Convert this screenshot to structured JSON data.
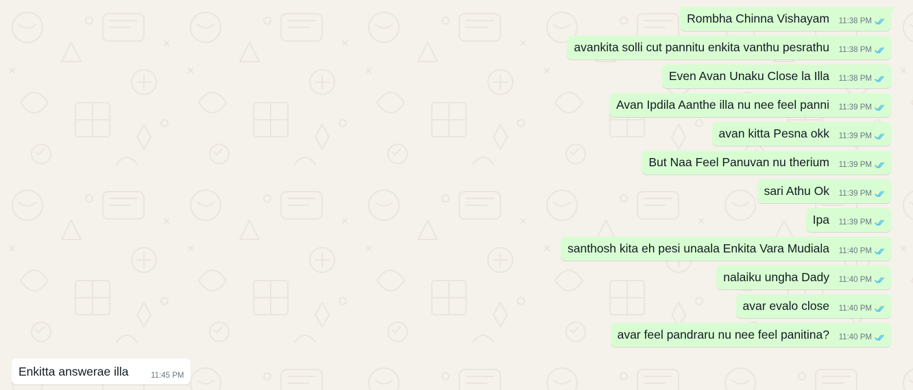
{
  "colors": {
    "outgoing_bubble": "#d9fdd3",
    "incoming_bubble": "#ffffff",
    "read_tick": "#53bdeb",
    "chat_background": "#f5f1eb"
  },
  "icons": {
    "read_receipt": "double-check-icon"
  },
  "messages": [
    {
      "direction": "out",
      "text": "Rombha Chinna Vishayam",
      "time": "11:38 PM",
      "status": "read"
    },
    {
      "direction": "out",
      "text": "avankita solli cut pannitu enkita vanthu pesrathu",
      "time": "11:38 PM",
      "status": "read"
    },
    {
      "direction": "out",
      "text": "Even Avan Unaku Close la Illa",
      "time": "11:38 PM",
      "status": "read"
    },
    {
      "direction": "out",
      "text": "Avan Ipdila Aanthe illa nu nee feel panni",
      "time": "11:39 PM",
      "status": "read"
    },
    {
      "direction": "out",
      "text": "avan kitta Pesna okk",
      "time": "11:39 PM",
      "status": "read"
    },
    {
      "direction": "out",
      "text": "But Naa Feel Panuvan nu therium",
      "time": "11:39 PM",
      "status": "read"
    },
    {
      "direction": "out",
      "text": "sari Athu Ok",
      "time": "11:39 PM",
      "status": "read"
    },
    {
      "direction": "out",
      "text": "Ipa",
      "time": "11:39 PM",
      "status": "read"
    },
    {
      "direction": "out",
      "text": "santhosh kita eh pesi unaala Enkita Vara Mudiala",
      "time": "11:40 PM",
      "status": "read"
    },
    {
      "direction": "out",
      "text": "nalaiku ungha Dady",
      "time": "11:40 PM",
      "status": "read"
    },
    {
      "direction": "out",
      "text": "avar evalo close",
      "time": "11:40 PM",
      "status": "read"
    },
    {
      "direction": "out",
      "text": "avar feel pandraru nu nee feel panitina?",
      "time": "11:40 PM",
      "status": "read"
    },
    {
      "direction": "in",
      "text": "Enkitta answerae illa",
      "time": "11:45 PM"
    }
  ]
}
